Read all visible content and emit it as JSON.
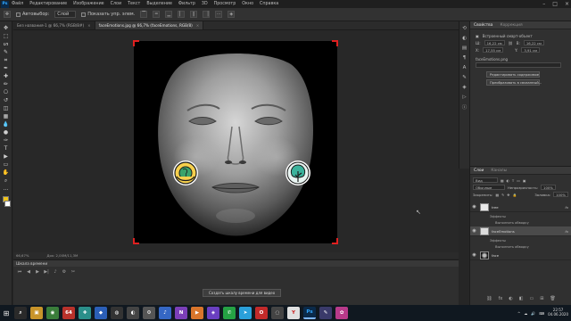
{
  "menubar": {
    "logo": "Ps",
    "items": [
      "Файл",
      "Редактирование",
      "Изображение",
      "Слои",
      "Текст",
      "Выделение",
      "Фильтр",
      "3D",
      "Просмотр",
      "Окно",
      "Справка"
    ],
    "window_controls": [
      "–",
      "□",
      "×"
    ]
  },
  "options": {
    "autoselect_label": "Автовыбор:",
    "autoselect_value": "Слой",
    "show_controls_label": "Показать упр. элем."
  },
  "toolbar": {
    "tools": [
      "move-icon",
      "marquee-icon",
      "lasso-icon",
      "quick-select-icon",
      "crop-icon",
      "eyedropper-icon",
      "healing-icon",
      "brush-icon",
      "stamp-icon",
      "history-brush-icon",
      "eraser-icon",
      "gradient-icon",
      "blur-icon",
      "dodge-icon",
      "pen-icon",
      "type-icon",
      "path-select-icon",
      "shape-icon",
      "hand-icon",
      "zoom-icon",
      "more-icon"
    ],
    "glyphs": [
      "✥",
      "⬚",
      "ᔕ",
      "✎",
      "⌗",
      "✒",
      "✚",
      "✏",
      "⎔",
      "↺",
      "◫",
      "▦",
      "💧",
      "●",
      "✑",
      "T",
      "▶",
      "▭",
      "✋",
      "⌕",
      "…"
    ],
    "fg_color": "#f0c419",
    "bg_color": "#ffffff"
  },
  "tabs": [
    {
      "label": "Без названия-1 @ 66,7% (RGB/8#)",
      "close": "×"
    },
    {
      "label": "faceEmotions.jpg @ 66,7% (faceEmotions, RGB/8)",
      "close": "×"
    }
  ],
  "status": {
    "zoom": "66,67%",
    "doc": "Док: 2,00M/11,3M"
  },
  "timeline": {
    "title": "Шкала времени",
    "create_button": "Создать шкалу времени для видео"
  },
  "panel_strip": [
    "history-icon",
    "adjust-icon",
    "libraries-icon",
    "paragraph-icon",
    "character-icon",
    "brush-settings-icon",
    "3d-icon",
    "actions-icon",
    "info-icon"
  ],
  "panel_strip_glyphs": [
    "⟲",
    "◐",
    "▤",
    "¶",
    "A",
    "✎",
    "◈",
    "▷",
    "ⓘ"
  ],
  "properties": {
    "title": "Свойства",
    "tab2": "Коррекция",
    "subtitle": "Встроенный смарт-объект",
    "w_label": "Ш:",
    "w_value": "16,22 см",
    "h_label": "В:",
    "h_value": "16,22 см",
    "x_label": "X:",
    "x_value": "17,55 см",
    "y_label": "Y:",
    "y_value": "3,91 см",
    "filename": "faceEmotions.png",
    "button1": "Редактировать содержимое",
    "button2": "Преобразовать в связанный..."
  },
  "layers": {
    "tab_active": "Слои",
    "tab_inactive": "Каналы",
    "kind_label": "Вид",
    "blend_mode": "Обычные",
    "opacity_label": "Непрозрачность:",
    "opacity_value": "100%",
    "lock_label": "Закрепить:",
    "fill_label": "Заливка:",
    "fill_value": "100%",
    "rows": [
      {
        "name": "tree",
        "fx": "fx"
      },
      {
        "name": "faceEmotions",
        "fx": "fx"
      },
      {
        "name": "face",
        "fx": ""
      }
    ],
    "effects_label": "Эффекты",
    "stroke_label": "Выполнить обводку",
    "footer": [
      "⛓",
      "fx",
      "◐",
      "◧",
      "▭",
      "⊞",
      "🗑"
    ]
  },
  "taskbar": {
    "start": "⊞",
    "apps": [
      {
        "name": "search-app",
        "glyph": "⌕",
        "color": "#2a2a2a"
      },
      {
        "name": "explorer-app",
        "glyph": "▣",
        "color": "#c8942a"
      },
      {
        "name": "chrome-app",
        "glyph": "◉",
        "color": "#3a7d3a"
      },
      {
        "name": "app-64",
        "glyph": "64",
        "color": "#b8322b"
      },
      {
        "name": "app-teal",
        "glyph": "✚",
        "color": "#2a8f8a"
      },
      {
        "name": "app-blue",
        "glyph": "◆",
        "color": "#2b5fb8"
      },
      {
        "name": "obs-app",
        "glyph": "◍",
        "color": "#333"
      },
      {
        "name": "app-dark",
        "glyph": "◐",
        "color": "#444"
      },
      {
        "name": "app-grey",
        "glyph": "⚙",
        "color": "#555"
      },
      {
        "name": "app-blue2",
        "glyph": "♪",
        "color": "#3567c4"
      },
      {
        "name": "app-purple",
        "glyph": "N",
        "color": "#7b3fb8"
      },
      {
        "name": "app-orange",
        "glyph": "▶",
        "color": "#d9752b"
      },
      {
        "name": "app-purple2",
        "glyph": "◈",
        "color": "#6a3fc1"
      },
      {
        "name": "whatsapp-app",
        "glyph": "✆",
        "color": "#25a244"
      },
      {
        "name": "telegram-app",
        "glyph": "➤",
        "color": "#2aa0da"
      },
      {
        "name": "app-o",
        "glyph": "O",
        "color": "#c22a2a"
      },
      {
        "name": "app-circle",
        "glyph": "◌",
        "color": "#444"
      },
      {
        "name": "yandex-app",
        "glyph": "Y",
        "color": "#e0e0e0"
      },
      {
        "name": "photoshop-app",
        "glyph": "Ps",
        "color": "#0a2a4a"
      },
      {
        "name": "app-note",
        "glyph": "✎",
        "color": "#3a3a6a"
      },
      {
        "name": "app-pink",
        "glyph": "✿",
        "color": "#b83a8a"
      }
    ],
    "time": "22:57",
    "date": "04.06.2020",
    "tray_icons": [
      "^",
      "☁",
      "🔊",
      "⌨"
    ]
  }
}
